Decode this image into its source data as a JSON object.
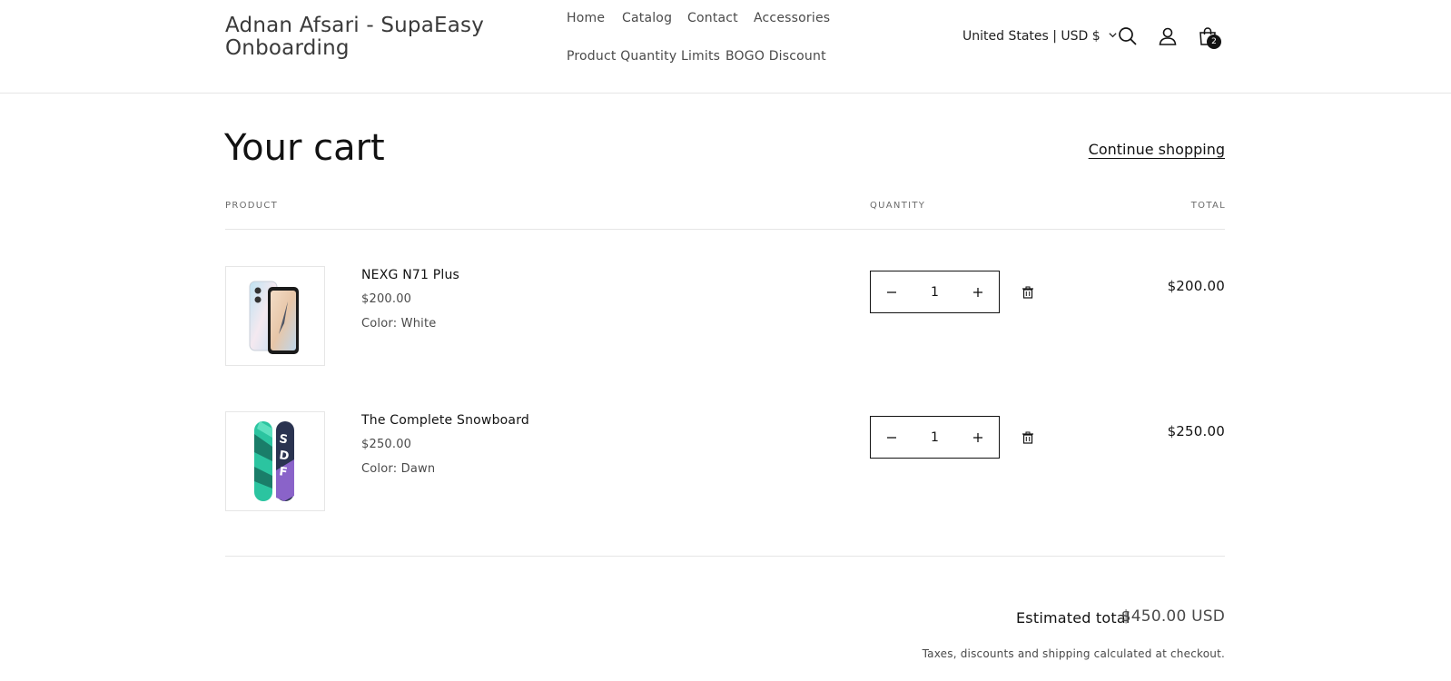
{
  "header": {
    "logo": "Adnan Afsari - SupaEasy Onboarding",
    "nav": [
      {
        "label": "Home"
      },
      {
        "label": "Catalog"
      },
      {
        "label": "Contact"
      },
      {
        "label": "Accessories"
      },
      {
        "label": "Product Quantity Limits"
      },
      {
        "label": "BOGO Discount"
      }
    ],
    "country_selector": "United States | USD $",
    "cart_count": "2",
    "icons": [
      "search-icon",
      "account-icon",
      "cart-icon",
      "chevron-down-icon"
    ]
  },
  "cart": {
    "title": "Your cart",
    "continue_link": "Continue shopping",
    "columns": {
      "product": "PRODUCT",
      "quantity": "QUANTITY",
      "total": "TOTAL"
    },
    "items": [
      {
        "name": "NEXG N71 Plus",
        "price": "$200.00",
        "variant_label": "Color:",
        "variant_value": "White",
        "quantity": "1",
        "line_total": "$200.00"
      },
      {
        "name": "The Complete Snowboard",
        "price": "$250.00",
        "variant_label": "Color:",
        "variant_value": "Dawn",
        "quantity": "1",
        "line_total": "$250.00"
      }
    ],
    "estimated_total_label": "Estimated total",
    "estimated_total_value": "$450.00 USD",
    "tax_note": "Taxes, discounts and shipping calculated at checkout."
  },
  "colors": {
    "text": "#121212",
    "muted": "#4a4a4a",
    "border": "#e6e6e6",
    "background": "#ffffff"
  }
}
